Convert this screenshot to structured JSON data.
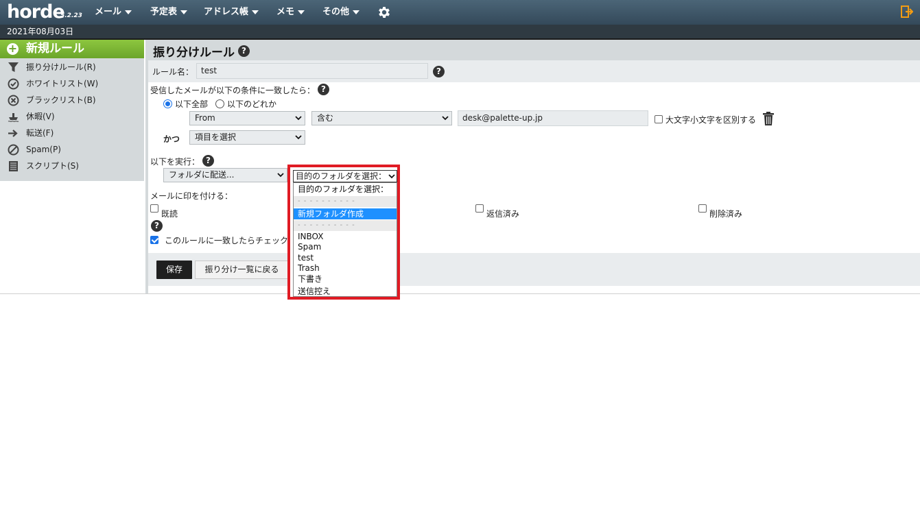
{
  "topbar": {
    "logo": "horde",
    "version": "5.2.23",
    "menus": [
      "メール",
      "予定表",
      "アドレス帳",
      "メモ",
      "その他"
    ],
    "settings_icon": "gear-icon",
    "logout_icon": "logout-icon"
  },
  "datebar": {
    "date": "2021年08月03日"
  },
  "sidebar": {
    "new_rule": "新規ルール",
    "items": [
      {
        "label": "振り分けルール(R)",
        "icon": "filter-icon"
      },
      {
        "label": "ホワイトリスト(W)",
        "icon": "check-circle-icon"
      },
      {
        "label": "ブラックリスト(B)",
        "icon": "x-circle-icon"
      },
      {
        "label": "休暇(V)",
        "icon": "vacation-icon"
      },
      {
        "label": "転送(F)",
        "icon": "arrow-right-icon"
      },
      {
        "label": "Spam(P)",
        "icon": "ban-icon"
      },
      {
        "label": "スクリプト(S)",
        "icon": "script-icon"
      }
    ]
  },
  "main": {
    "title": "振り分けルール",
    "rule_name_label": "ルール名：",
    "rule_name_value": "test",
    "condition_label": "受信したメールが以下の条件に一致したら：",
    "radio_all": "以下全部",
    "radio_any": "以下のどれか",
    "cond_field": "From",
    "cond_op": "含む",
    "cond_value": "desk@palette-up.jp",
    "case_sensitive_label": "大文字小文字を区別する",
    "and_label": "かつ",
    "add_item_select": "項目を選択",
    "action_label": "以下を実行：",
    "action_select": "フォルダに配送...",
    "flag_label": "メールに印を付ける：",
    "flags": [
      "既読",
      "返信済み",
      "削除済み"
    ],
    "stop_label": "このルールに一致したらチェック",
    "save_button": "保存",
    "back_button": "振り分け一覧に戻る"
  },
  "dropdown": {
    "selected_display": "目的のフォルダを選択：",
    "options": [
      {
        "label": "目的のフォルダを選択：",
        "type": "option"
      },
      {
        "label": "- - - - - - - - - -",
        "type": "sep"
      },
      {
        "label": "新規フォルダ作成",
        "type": "selected"
      },
      {
        "label": "- - - - - - - - - -",
        "type": "sep"
      },
      {
        "label": "INBOX",
        "type": "option"
      },
      {
        "label": "Spam",
        "type": "option"
      },
      {
        "label": "test",
        "type": "option"
      },
      {
        "label": "Trash",
        "type": "option"
      },
      {
        "label": "下書き",
        "type": "option"
      },
      {
        "label": "送信控え",
        "type": "option"
      }
    ],
    "highlight_color": "#e01b24"
  }
}
